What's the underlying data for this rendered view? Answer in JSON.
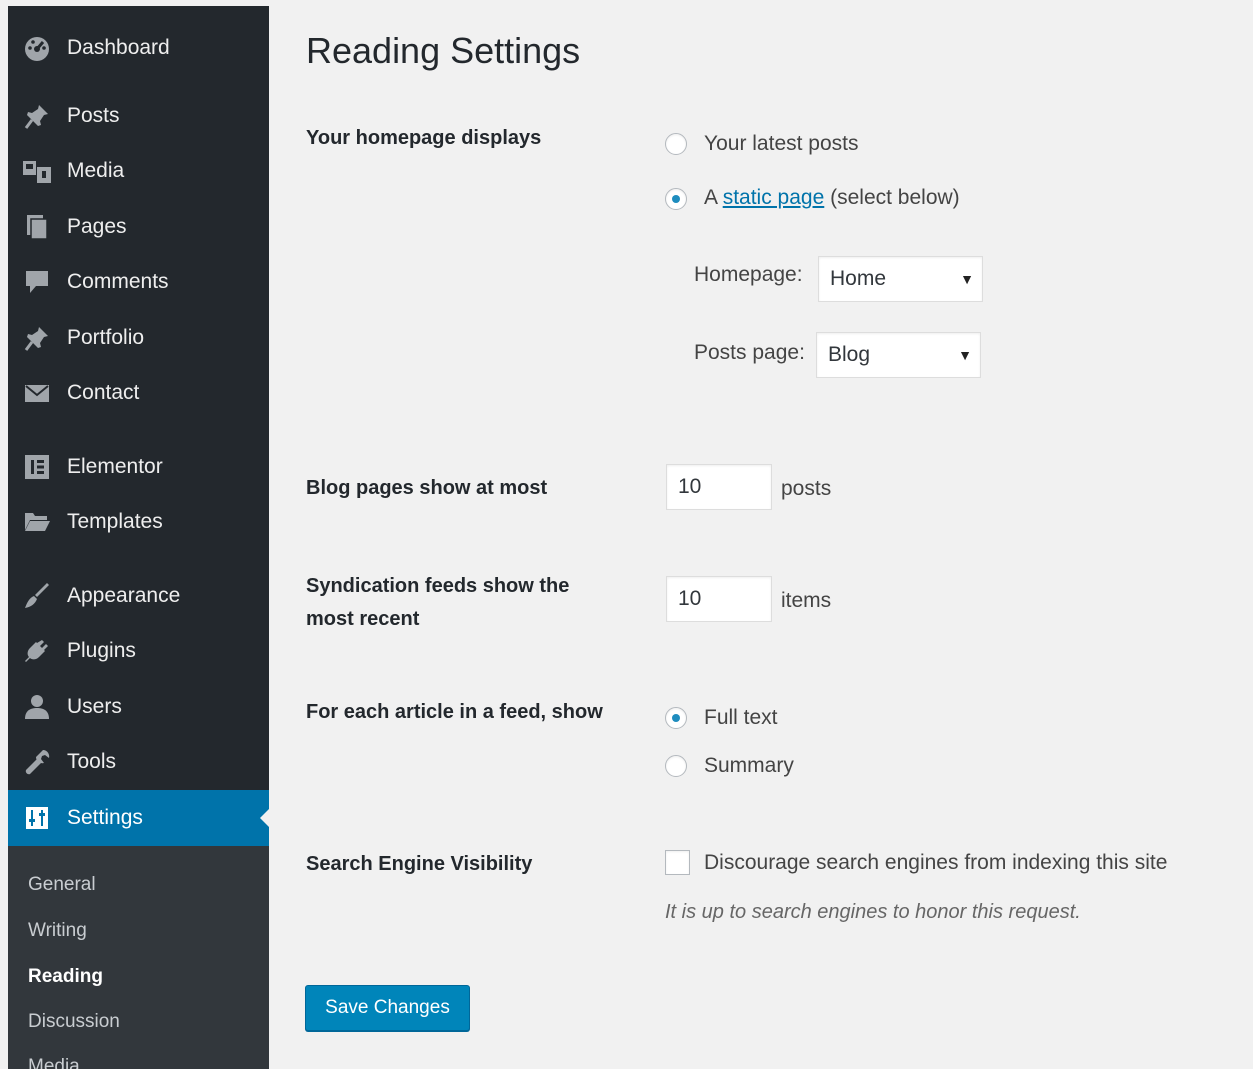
{
  "sidebar": {
    "items": [
      {
        "label": "Dashboard",
        "icon": "dashboard-icon"
      },
      {
        "label": "Posts",
        "icon": "pin-icon"
      },
      {
        "label": "Media",
        "icon": "media-icon"
      },
      {
        "label": "Pages",
        "icon": "pages-icon"
      },
      {
        "label": "Comments",
        "icon": "comment-icon"
      },
      {
        "label": "Portfolio",
        "icon": "pin-icon"
      },
      {
        "label": "Contact",
        "icon": "envelope-icon"
      },
      {
        "label": "Elementor",
        "icon": "elementor-icon"
      },
      {
        "label": "Templates",
        "icon": "folder-icon"
      },
      {
        "label": "Appearance",
        "icon": "brush-icon"
      },
      {
        "label": "Plugins",
        "icon": "plug-icon"
      },
      {
        "label": "Users",
        "icon": "user-icon"
      },
      {
        "label": "Tools",
        "icon": "wrench-icon"
      },
      {
        "label": "Settings",
        "icon": "settings-icon"
      }
    ],
    "submenu": [
      "General",
      "Writing",
      "Reading",
      "Discussion",
      "Media"
    ],
    "active_submenu": "Reading",
    "colors": {
      "bg": "#23282d",
      "current": "#0073aa",
      "submenu_bg": "#32373c"
    }
  },
  "main": {
    "title": "Reading Settings",
    "homepage_displays": {
      "label": "Your homepage displays",
      "options": [
        "Your latest posts",
        "A",
        "static page",
        "(select below)"
      ],
      "selected": "static page",
      "homepage_label": "Homepage:",
      "homepage_value": "Home",
      "posts_page_label": "Posts page:",
      "posts_page_value": "Blog"
    },
    "blog_pages": {
      "label": "Blog pages show at most",
      "value": "10",
      "unit": "posts"
    },
    "syndication": {
      "label_line1": "Syndication feeds show the",
      "label_line2": "most recent",
      "value": "10",
      "unit": "items"
    },
    "feed_article": {
      "label": "For each article in a feed, show",
      "options": [
        "Full text",
        "Summary"
      ],
      "selected": "Full text"
    },
    "search_visibility": {
      "label": "Search Engine Visibility",
      "checkbox_label": "Discourage search engines from indexing this site",
      "checked": false,
      "description": "It is up to search engines to honor this request."
    },
    "save_label": "Save Changes"
  }
}
